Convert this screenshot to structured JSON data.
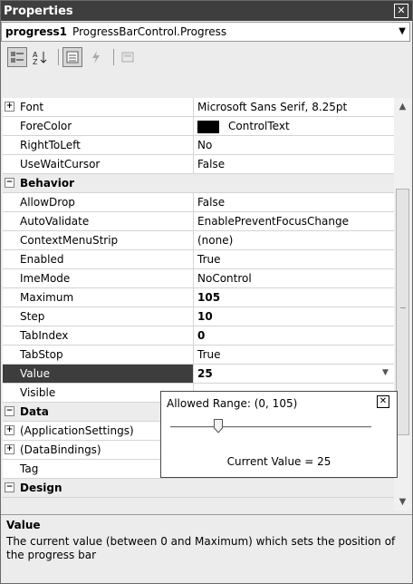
{
  "window": {
    "title": "Properties"
  },
  "object_selector": {
    "name": "progress1",
    "type": "ProgressBarControl.Progress"
  },
  "toolbar": {
    "icons": [
      "categorized-icon",
      "alphabetical-icon",
      "properties-icon",
      "events-icon",
      "property-pages-icon"
    ]
  },
  "grid": {
    "rows": [
      {
        "kind": "prop",
        "expander": "+",
        "name": "Font",
        "value": "Microsoft Sans Serif, 8.25pt"
      },
      {
        "kind": "prop",
        "name": "ForeColor",
        "value": "ControlText",
        "swatch": "#000000"
      },
      {
        "kind": "prop",
        "name": "RightToLeft",
        "value": "No"
      },
      {
        "kind": "prop",
        "name": "UseWaitCursor",
        "value": "False"
      },
      {
        "kind": "cat",
        "name": "Behavior"
      },
      {
        "kind": "prop",
        "name": "AllowDrop",
        "value": "False"
      },
      {
        "kind": "prop",
        "name": "AutoValidate",
        "value": "EnablePreventFocusChange"
      },
      {
        "kind": "prop",
        "name": "ContextMenuStrip",
        "value": "(none)"
      },
      {
        "kind": "prop",
        "name": "Enabled",
        "value": "True"
      },
      {
        "kind": "prop",
        "name": "ImeMode",
        "value": "NoControl"
      },
      {
        "kind": "prop",
        "name": "Maximum",
        "value": "105",
        "bold": true
      },
      {
        "kind": "prop",
        "name": "Step",
        "value": "10",
        "bold": true
      },
      {
        "kind": "prop",
        "name": "TabIndex",
        "value": "0",
        "bold": true
      },
      {
        "kind": "prop",
        "name": "TabStop",
        "value": "True"
      },
      {
        "kind": "prop",
        "name": "Value",
        "value": "25",
        "bold": true,
        "selected": true
      },
      {
        "kind": "prop",
        "name": "Visible",
        "value": ""
      },
      {
        "kind": "cat",
        "name": "Data"
      },
      {
        "kind": "prop",
        "expander": "+",
        "name": "(ApplicationSettings)",
        "value": ""
      },
      {
        "kind": "prop",
        "expander": "+",
        "name": "(DataBindings)",
        "value": ""
      },
      {
        "kind": "prop",
        "name": "Tag",
        "value": ""
      },
      {
        "kind": "cat",
        "name": "Design"
      }
    ]
  },
  "popup": {
    "allowed_range": "Allowed Range: (0, 105)",
    "current_value_label": "Current Value = 25",
    "slider_fraction": 0.238
  },
  "description": {
    "title": "Value",
    "text": "The current value (between 0 and Maximum) which sets the position of the progress bar"
  }
}
